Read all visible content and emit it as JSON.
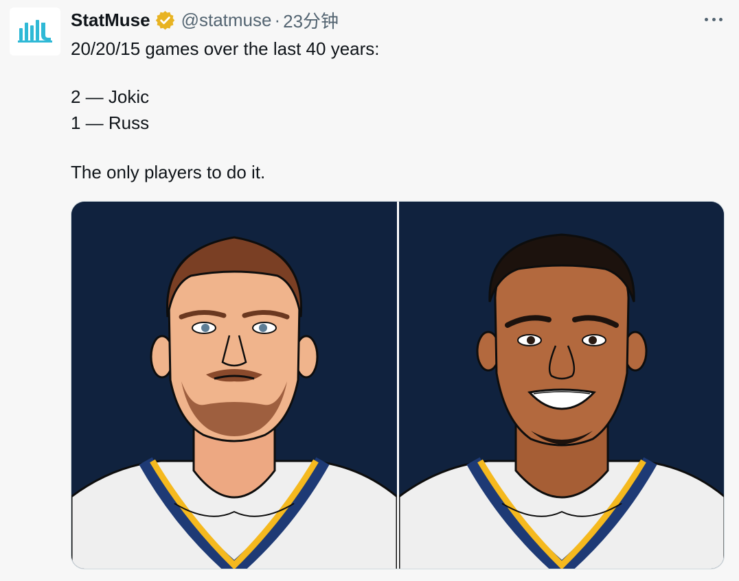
{
  "tweet": {
    "author": {
      "name": "StatMuse",
      "handle": "@statmuse",
      "separator": "·",
      "time": "23分钟",
      "verified": true,
      "badge_color": "#e8b322",
      "avatar_color": "#2fb9d6"
    },
    "text_lines": [
      "20/20/15 games over the last 40 years:",
      "2 — Jokic",
      "1 — Russ",
      "The only players to do it."
    ],
    "media": {
      "images": [
        {
          "subject": "Jokic",
          "background": "#10223e",
          "skin": "#f0b48c",
          "hair": "#7a3f24"
        },
        {
          "subject": "Russ",
          "background": "#10223e",
          "skin": "#b3693e",
          "hair": "#1c120d"
        }
      ],
      "jersey_colors": {
        "base": "#efefef",
        "navy": "#1e3a75",
        "gold": "#f5b91e"
      }
    }
  }
}
